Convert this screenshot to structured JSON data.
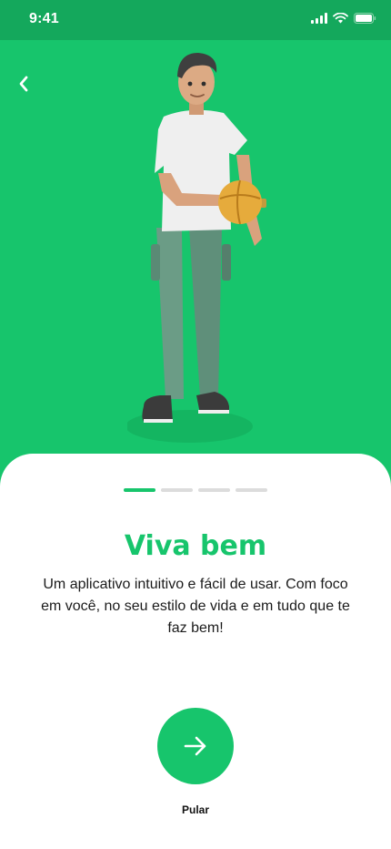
{
  "status_bar": {
    "time": "9:41",
    "icons": [
      "signal-icon",
      "wifi-icon",
      "battery-icon"
    ]
  },
  "header": {
    "back_icon": "chevron-left-icon"
  },
  "onboarding": {
    "pager": {
      "total": 4,
      "active_index": 0
    },
    "title": "Viva bem",
    "description": "Um aplicativo intuitivo e fácil de usar. Com foco em você, no seu estilo de vida e em tudo que te faz bem!",
    "next_icon": "arrow-right-icon",
    "skip_label": "Pular"
  },
  "colors": {
    "brand": "#17c56c",
    "status_bar": "#14a85c",
    "text": "#1b1b1b",
    "pager_inactive": "#dcdcdc"
  }
}
